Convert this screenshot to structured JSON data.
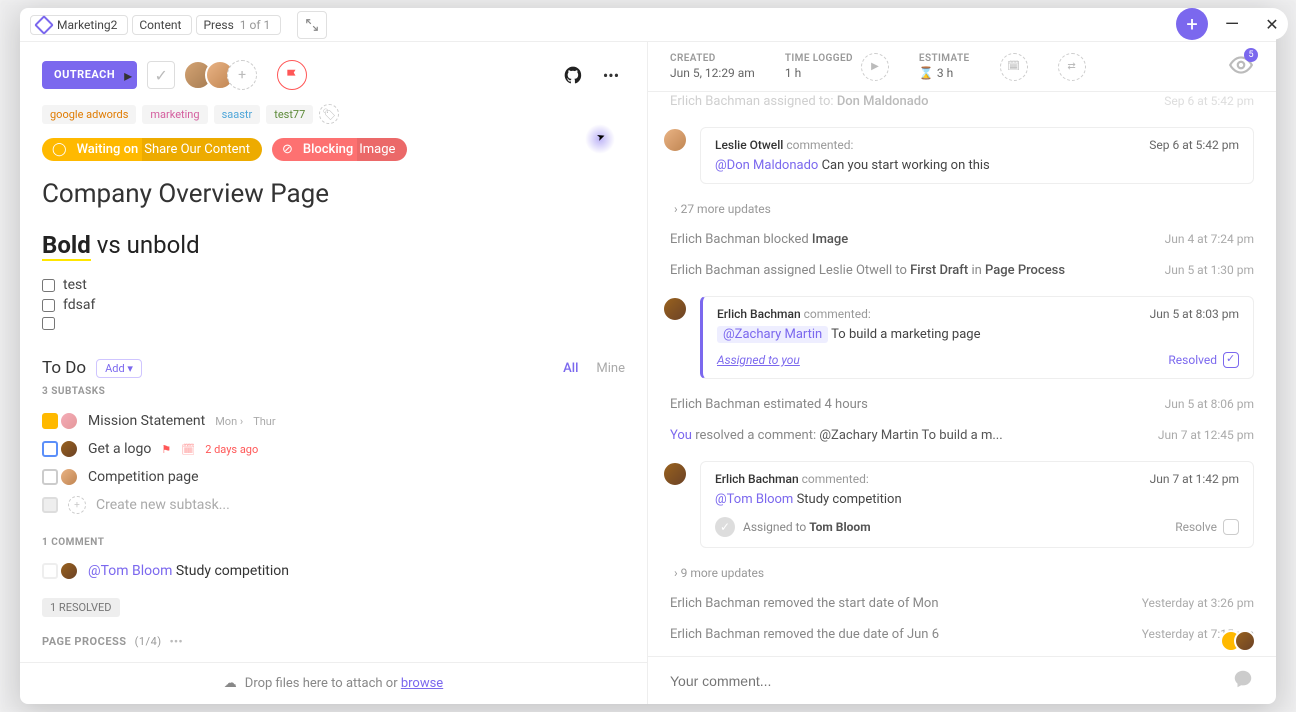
{
  "breadcrumb": {
    "workspace": "Marketing2",
    "folder": "Content",
    "list": "Press",
    "list_count": "1 of 1"
  },
  "task": {
    "status_label": "OUTREACH",
    "title": "Company Overview Page",
    "rich_bold": "Bold",
    "rich_rest": " vs unbold",
    "tags": [
      "google adwords",
      "marketing",
      "saastr",
      "test77"
    ],
    "dependencies": {
      "waiting_label": "Waiting on",
      "waiting_title": "Share Our Content",
      "blocking_label": "Blocking",
      "blocking_title": "Image"
    },
    "checklist": [
      "test",
      "fdsaf"
    ]
  },
  "meta": {
    "created_label": "CREATED",
    "created_value": "Jun 5, 12:29 am",
    "time_logged_label": "TIME LOGGED",
    "time_logged_value": "1 h",
    "estimate_label": "ESTIMATE",
    "estimate_value": "3 h",
    "watchers": "5"
  },
  "subtasks": {
    "header": "To Do",
    "add_label": "Add ▾",
    "filter_all": "All",
    "filter_mine": "Mine",
    "count_label": "3 SUBTASKS",
    "items": [
      {
        "title": "Mission Statement",
        "start": "Mon ›",
        "due": "Thur"
      },
      {
        "title": "Get a logo",
        "due": "2 days ago"
      },
      {
        "title": "Competition page"
      }
    ],
    "create_placeholder": "Create new subtask..."
  },
  "comments": {
    "section_label": "1 COMMENT",
    "mention": "@Tom Bloom",
    "text": "Study competition",
    "resolved_chip": "1 RESOLVED"
  },
  "page_process": {
    "label": "PAGE PROCESS",
    "fraction": "(1/4)"
  },
  "dropzone": {
    "text": "Drop files here to attach or ",
    "browse": "browse"
  },
  "activity": {
    "line0": {
      "text": "Erlich Bachman assigned to: ",
      "bold": "Don Maldonado",
      "time": "Sep 6 at 5:42 pm"
    },
    "c1": {
      "who": "Leslie Otwell",
      "verb": "commented:",
      "mention": "@Don Maldonado",
      "text": " Can you start working on this",
      "time": "Sep 6 at 5:42 pm"
    },
    "more1": "27 more updates",
    "line1": {
      "text": "Erlich Bachman blocked ",
      "bold": "Image",
      "time": "Jun 4 at 7:24 pm"
    },
    "line2": {
      "text": "Erlich Bachman assigned Leslie Otwell to ",
      "bold": "First Draft",
      "mid": " in ",
      "bold2": "Page Process",
      "time": "Jun 5 at 1:30 pm"
    },
    "c2": {
      "who": "Erlich Bachman",
      "verb": "commented:",
      "mention": "@Zachary Martin",
      "text": " To build a marketing page",
      "assigned": "Assigned to you",
      "resolved": "Resolved",
      "time": "Jun 5 at 8:03 pm"
    },
    "line3": {
      "text": "Erlich Bachman estimated 4 hours",
      "time": "Jun 5 at 8:06 pm"
    },
    "line4": {
      "pre": "You",
      "text": " resolved a comment: ",
      "rest": "@Zachary Martin To build a m...",
      "time": "Jun 7 at 12:45 pm"
    },
    "c3": {
      "who": "Erlich Bachman",
      "verb": "commented:",
      "mention": "@Tom Bloom",
      "text": " Study competition",
      "assigned_to": "Tom Bloom",
      "assigned_label": "Assigned to ",
      "resolve": "Resolve",
      "time": "Jun 7 at 1:42 pm"
    },
    "more2": "9 more updates",
    "line5": {
      "text": "Erlich Bachman removed the start date of Mon",
      "time": "Yesterday at 3:26 pm"
    },
    "line6": {
      "text": "Erlich Bachman removed the due date of Jun 6",
      "time": "Yesterday at 7:15 pm"
    }
  },
  "comment_input": {
    "placeholder": "Your comment..."
  }
}
